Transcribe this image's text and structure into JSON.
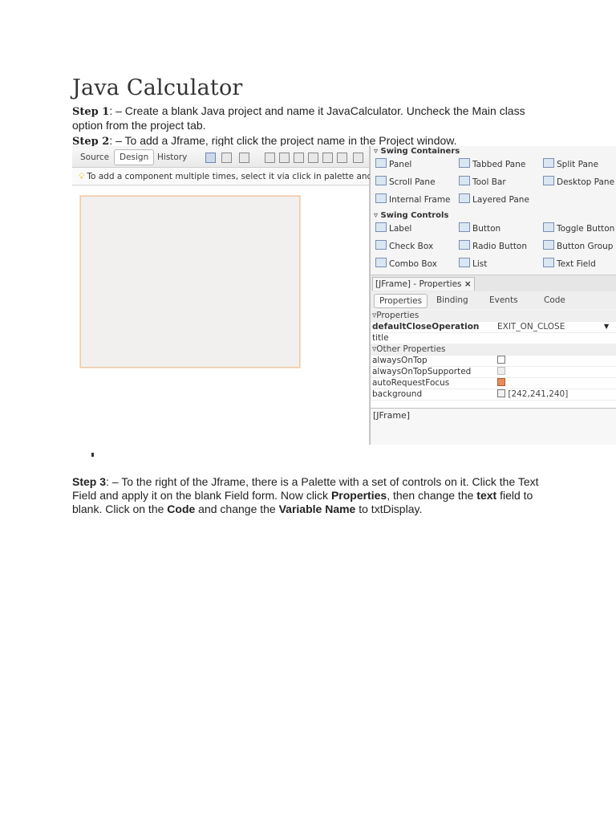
{
  "doc": {
    "title": "Java Calculator",
    "step1_label": "Step 1",
    "step1_text": ": – Create a blank Java project and name it JavaCalculator. Uncheck the Main class option from the project tab.",
    "step2_label": "Step 2",
    "step2_text": ": – To add a Jframe, right click the project name in the Project window.",
    "step3_label": "Step 3",
    "step3_t1": ": – To the right of the Jframe, there is a Palette with a set of controls on it. Click the Text Field and apply it on the blank Field form. Now click ",
    "step3_b1": "Properties",
    "step3_t2": ", then change the ",
    "step3_b2": "text",
    "step3_t3": " field to blank. Click on the ",
    "step3_b3": "Code",
    "step3_t4": " and change the ",
    "step3_b4": "Variable Name",
    "step3_t5": " to txtDisplay."
  },
  "editor": {
    "tabs": [
      "Source",
      "Design",
      "History"
    ],
    "hint": "To add a component multiple times, select it via click in palette and then Sh"
  },
  "palette": {
    "swing_containers": "Swing Containers",
    "containers": [
      "Panel",
      "Tabbed Pane",
      "Split Pane",
      "Scroll Pane",
      "Tool Bar",
      "Desktop Pane",
      "Internal Frame",
      "Layered Pane"
    ],
    "swing_controls": "Swing Controls",
    "controls": [
      "Label",
      "Button",
      "Toggle Button",
      "Check Box",
      "Radio Button",
      "Button Group",
      "Combo Box",
      "List",
      "Text Field"
    ]
  },
  "properties": {
    "window_tab": "[JFrame] - Properties",
    "close_glyph": "×",
    "subtabs": [
      "Properties",
      "Binding",
      "Events",
      "Code"
    ],
    "group1": "Properties",
    "group2": "Other Properties",
    "rows": [
      {
        "name": "defaultCloseOperation",
        "value": "EXIT_ON_CLOSE"
      },
      {
        "name": "title",
        "value": ""
      },
      {
        "name": "alwaysOnTop",
        "value": ""
      },
      {
        "name": "alwaysOnTopSupported",
        "value": ""
      },
      {
        "name": "autoRequestFocus",
        "value": ""
      },
      {
        "name": "background",
        "value": "[242,241,240]"
      }
    ],
    "footer": "[JFrame]"
  },
  "colors": {
    "form_border": "#f0c9a6",
    "checked": "#e98a5a",
    "hint_bulb": "#d8b400"
  }
}
